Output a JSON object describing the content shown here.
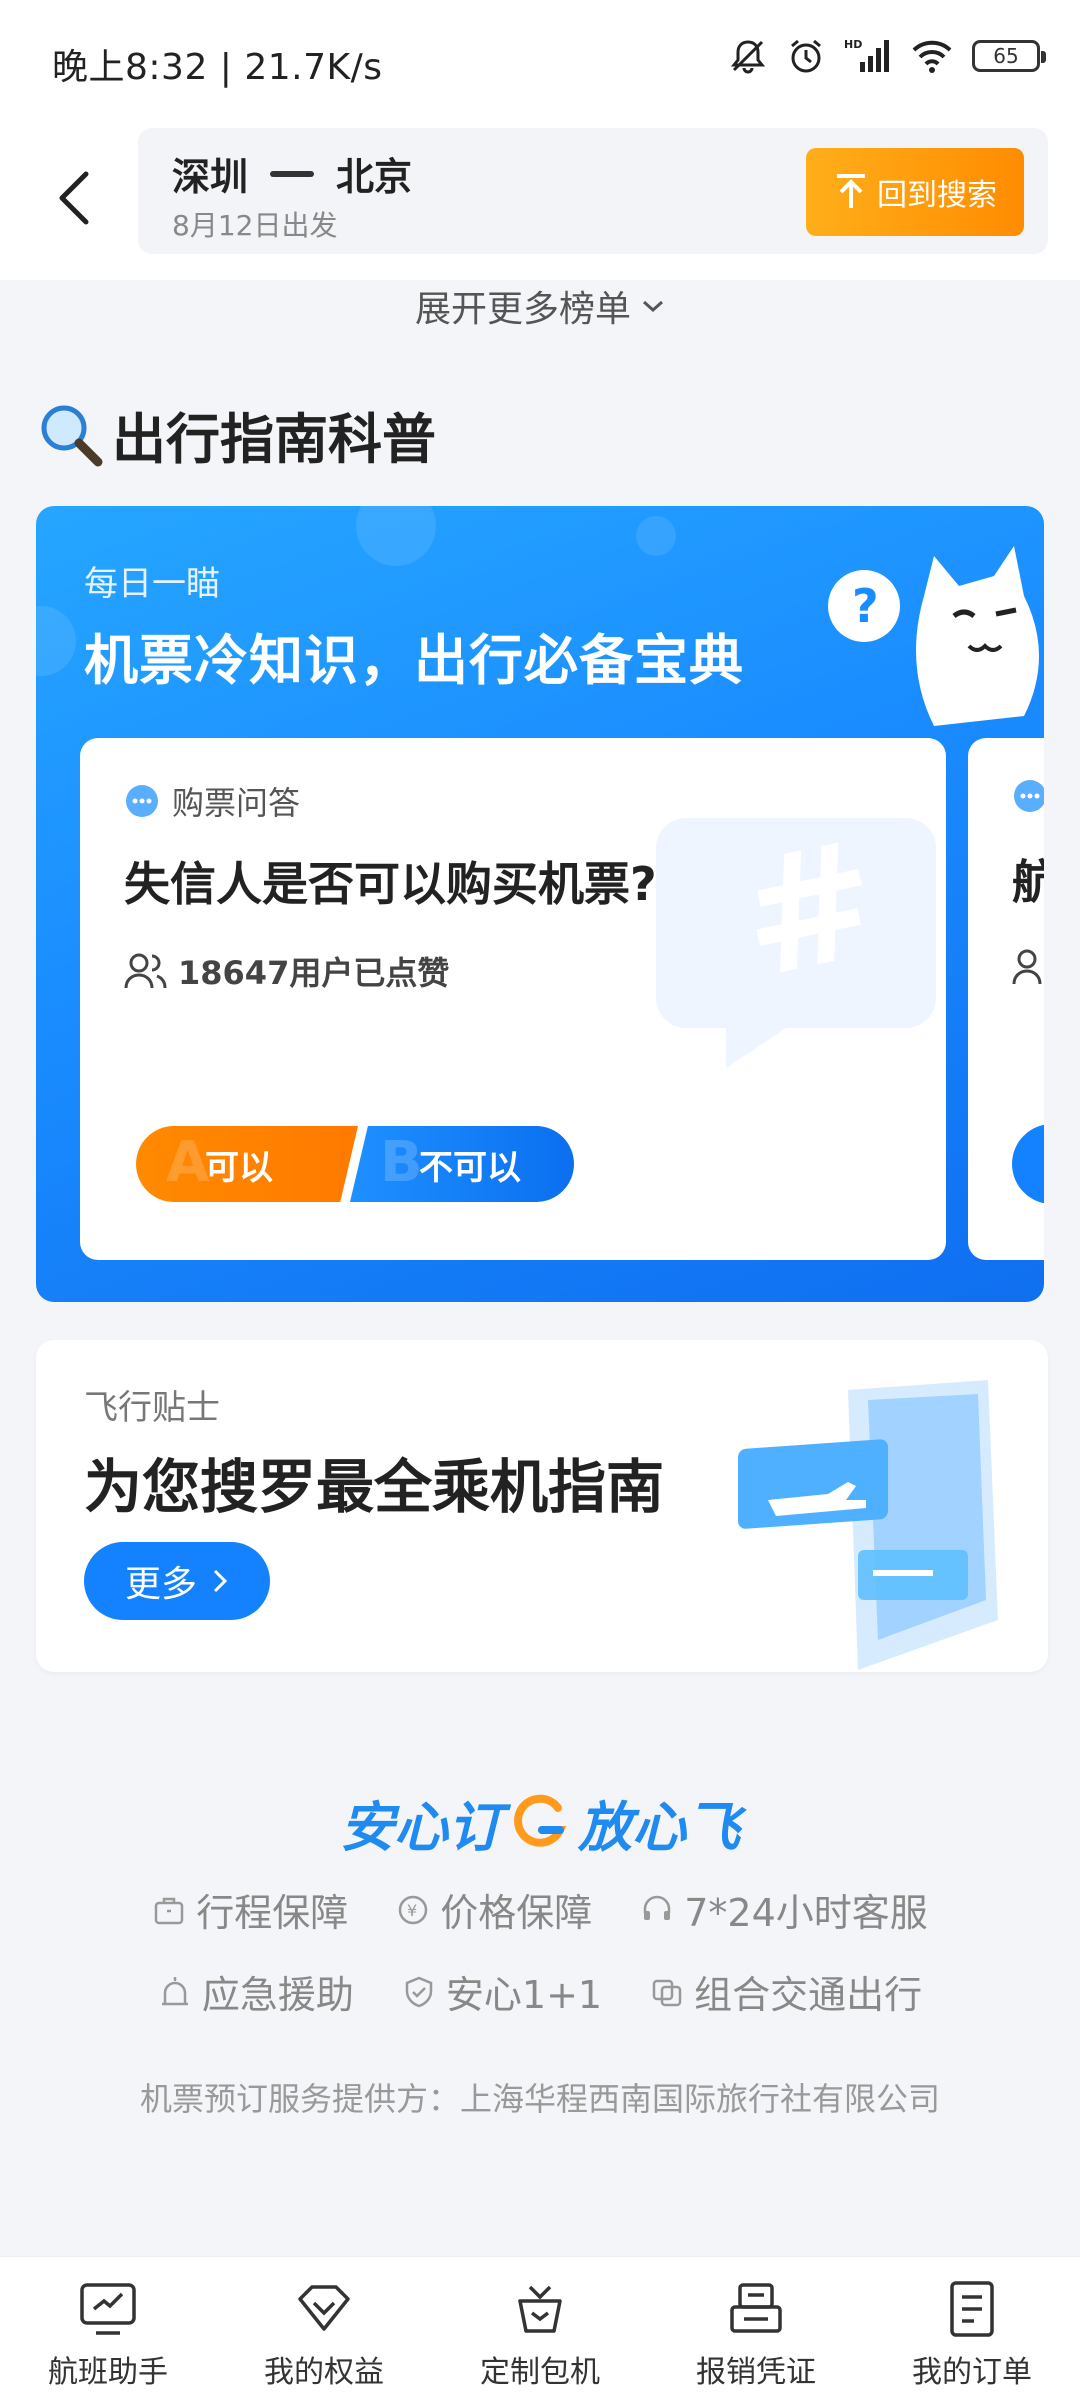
{
  "status_bar": {
    "time": "晚上8:32 | 21.7K/s",
    "battery": "65"
  },
  "header": {
    "from": "深圳",
    "to": "北京",
    "date": "8月12日出发",
    "back_to_search": "回到搜索"
  },
  "expand_more": "展开更多榜单",
  "section_title": "出行指南科普",
  "daily_banner": {
    "subtitle": "每日一瞄",
    "title": "机票冷知识，出行必备宝典",
    "card": {
      "tag": "购票问答",
      "question": "失信人是否可以购买机票?",
      "likes": "18647用户已点赞",
      "option_a": "可以",
      "option_b": "不可以",
      "letter_a": "A",
      "letter_b": "B"
    },
    "peek_card": {
      "question": "航"
    }
  },
  "tips_card": {
    "subtitle": "飞行贴士",
    "title": "为您搜罗最全乘机指南",
    "more": "更多"
  },
  "assurance": {
    "logo_left": "安心订",
    "logo_right": "放心飞",
    "row1": [
      "行程保障",
      "价格保障",
      "7*24小时客服"
    ],
    "row2": [
      "应急援助",
      "安心1+1",
      "组合交通出行"
    ],
    "provider": "机票预订服务提供方：上海华程西南国际旅行社有限公司"
  },
  "bottom_nav": [
    {
      "label": "航班助手",
      "icon": "flight-assistant-icon"
    },
    {
      "label": "我的权益",
      "icon": "diamond-icon"
    },
    {
      "label": "定制包机",
      "icon": "charter-icon"
    },
    {
      "label": "报销凭证",
      "icon": "receipt-icon"
    },
    {
      "label": "我的订单",
      "icon": "order-list-icon"
    }
  ]
}
